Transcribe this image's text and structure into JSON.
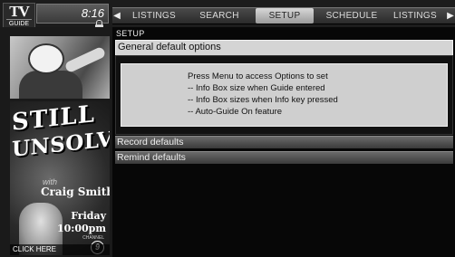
{
  "logo": {
    "line1": "TV",
    "line2": "GUIDE"
  },
  "clock": {
    "time": "8:16"
  },
  "nav": {
    "tabs": [
      {
        "label": "LISTINGS"
      },
      {
        "label": "SEARCH"
      },
      {
        "label": "SETUP",
        "active": true
      },
      {
        "label": "SCHEDULE"
      },
      {
        "label": "LISTINGS"
      }
    ]
  },
  "promo": {
    "title_line1": "STILL",
    "title_line2": "UNSOLVED",
    "with": "with",
    "host": "Craig Smith",
    "day": "Friday",
    "time": "10:00pm",
    "channel_label": "CHANNEL",
    "channel_number": "9",
    "click_here": "CLICK HERE"
  },
  "main": {
    "breadcrumb": "SETUP",
    "sections": [
      {
        "title": "General default options",
        "expanded": true
      },
      {
        "title": "Record defaults",
        "expanded": false
      },
      {
        "title": "Remind defaults",
        "expanded": false
      }
    ],
    "info_lines": [
      "Press Menu to access Options to set",
      "-- Info Box size when Guide entered",
      "-- Info Box sizes when Info key pressed",
      "-- Auto-Guide On feature"
    ]
  },
  "colors": {
    "active_tab": "#c8c8c8",
    "expanded_header": "#d4d4d4",
    "collapsed_header": "#555555",
    "background": "#0a0a0a"
  }
}
